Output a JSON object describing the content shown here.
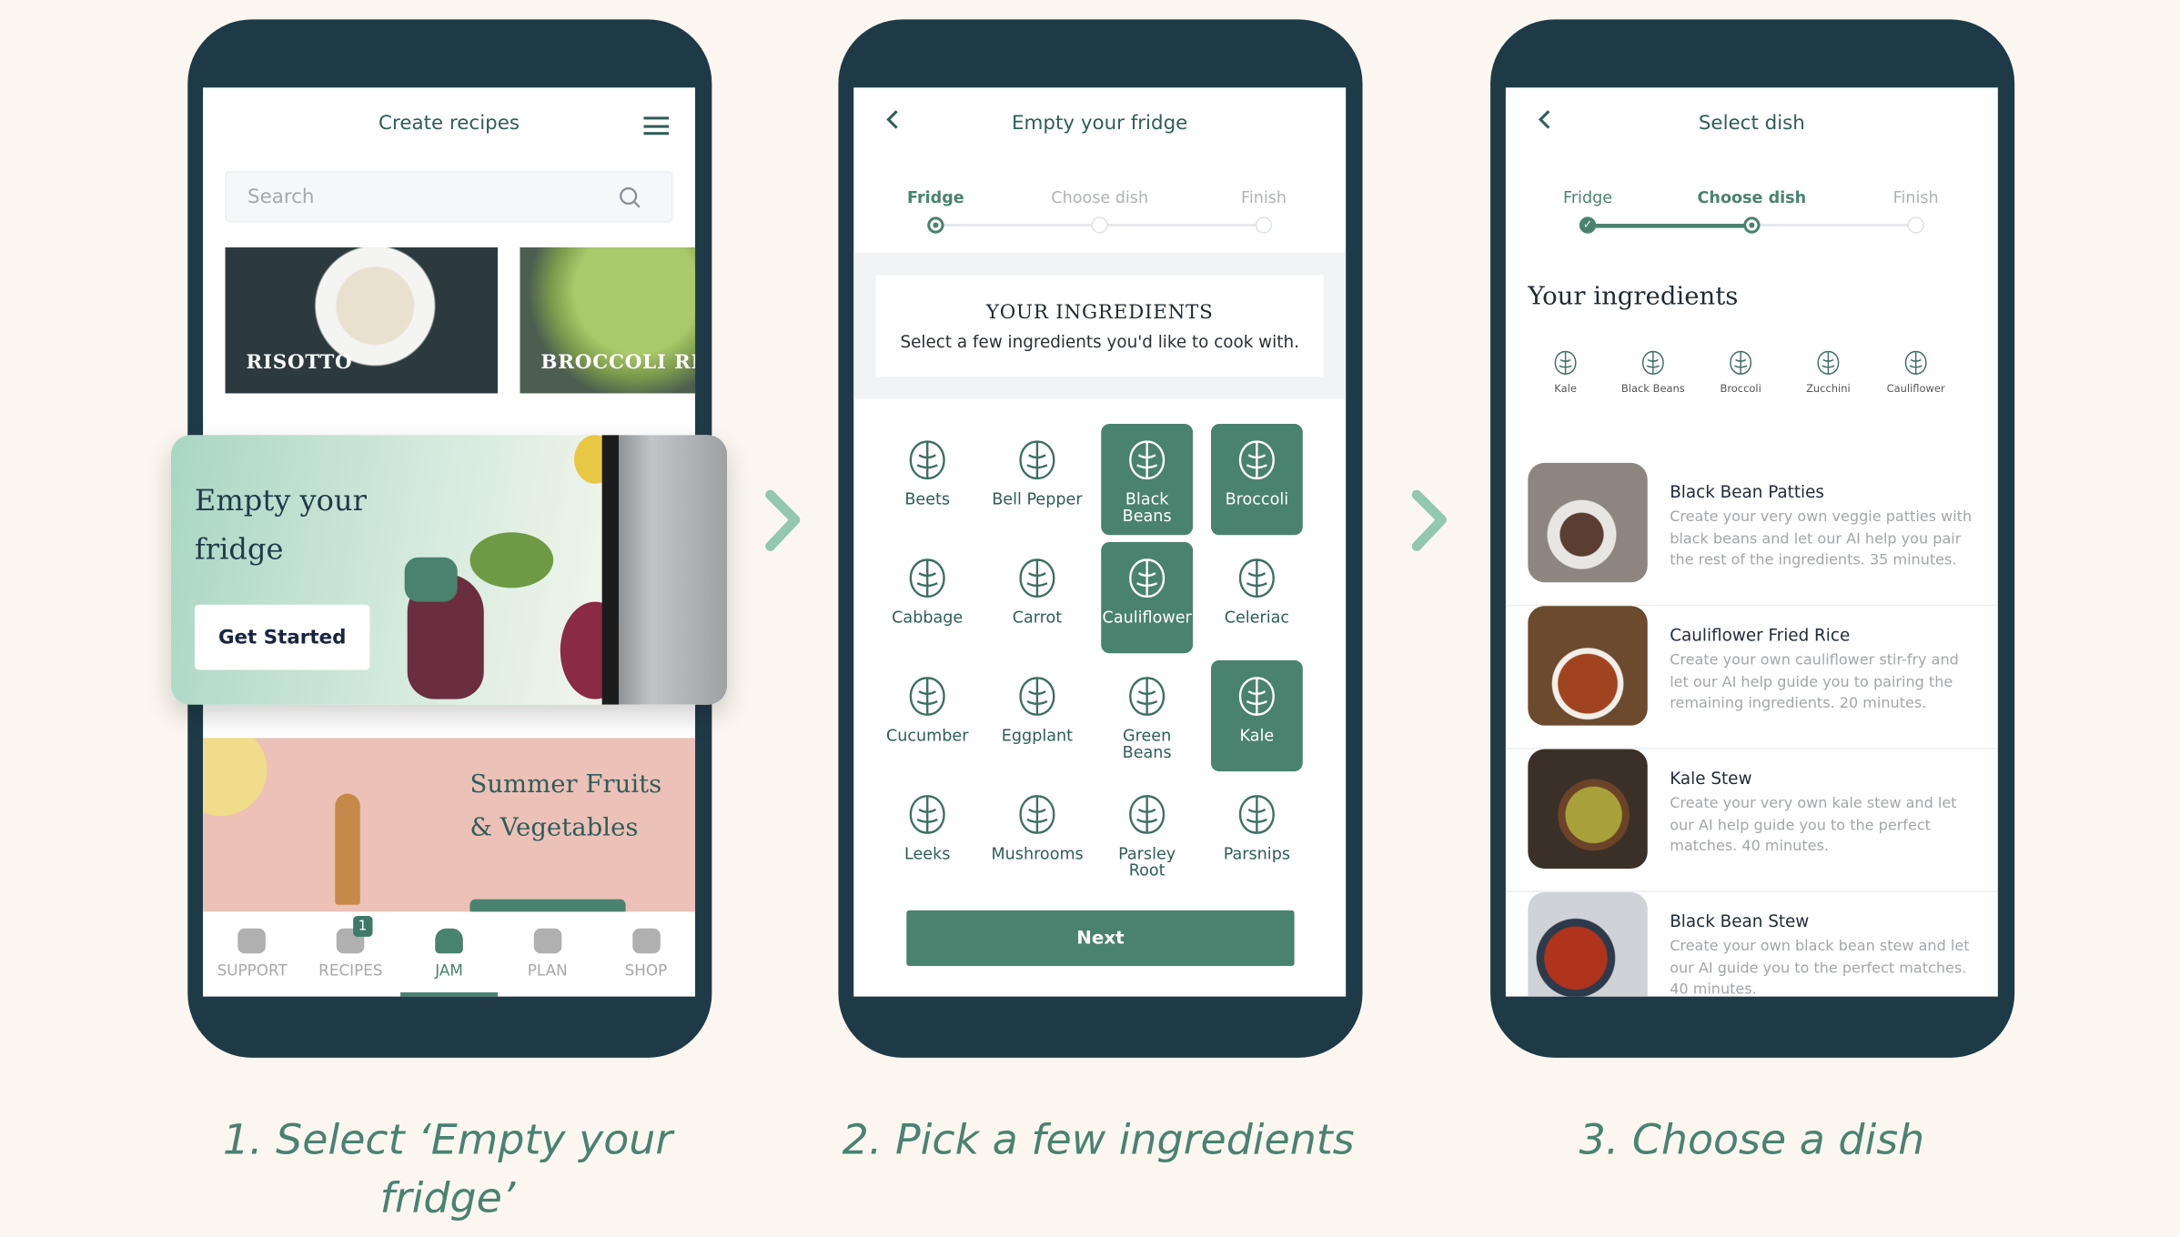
{
  "colors": {
    "accent": "#4a8270",
    "phone": "#1f3a47",
    "background": "#fbf7f0",
    "banner_pink": "#ecc1b8"
  },
  "screen1": {
    "title": "Create recipes",
    "search_placeholder": "Search",
    "recipes": [
      "RISOTTO",
      "BROCCOLI RIC"
    ],
    "banner": {
      "title": "Empty your fridge",
      "button": "Get Started"
    },
    "promo": "Summer Fruits & Vegetables",
    "nav": [
      {
        "label": "SUPPORT",
        "icon": "chat-icon"
      },
      {
        "label": "RECIPES",
        "icon": "book-icon",
        "badge": "1"
      },
      {
        "label": "JAM",
        "icon": "chef-hat-icon",
        "active": true
      },
      {
        "label": "PLAN",
        "icon": "calendar-icon"
      },
      {
        "label": "SHOP",
        "icon": "shopping-bag-icon"
      }
    ]
  },
  "screen2": {
    "title": "Empty your fridge",
    "steps": [
      "Fridge",
      "Choose dish",
      "Finish"
    ],
    "card_title": "YOUR INGREDIENTS",
    "card_subtitle": "Select a few ingredients you'd like to cook with.",
    "ingredients": [
      {
        "label": "Beets",
        "selected": false
      },
      {
        "label": "Bell Pepper",
        "selected": false
      },
      {
        "label": "Black Beans",
        "selected": true
      },
      {
        "label": "Broccoli",
        "selected": true
      },
      {
        "label": "Cabbage",
        "selected": false
      },
      {
        "label": "Carrot",
        "selected": false
      },
      {
        "label": "Cauliflower",
        "selected": true
      },
      {
        "label": "Celeriac",
        "selected": false
      },
      {
        "label": "Cucumber",
        "selected": false
      },
      {
        "label": "Eggplant",
        "selected": false
      },
      {
        "label": "Green Beans",
        "selected": false
      },
      {
        "label": "Kale",
        "selected": true
      },
      {
        "label": "Leeks",
        "selected": false
      },
      {
        "label": "Mushrooms",
        "selected": false
      },
      {
        "label": "Parsley Root",
        "selected": false
      },
      {
        "label": "Parsnips",
        "selected": false
      }
    ],
    "next": "Next"
  },
  "screen3": {
    "title": "Select dish",
    "steps": [
      "Fridge",
      "Choose dish",
      "Finish"
    ],
    "heading": "Your ingredients",
    "chips": [
      "Kale",
      "Black Beans",
      "Broccoli",
      "Zucchini",
      "Cauliflower"
    ],
    "dishes": [
      {
        "title": "Black Bean Patties",
        "desc": "Create your very own veggie patties with black beans and let our AI help you pair the rest of the ingredients. 35 minutes."
      },
      {
        "title": "Cauliflower Fried Rice",
        "desc": "Create your own cauliflower stir-fry and let our AI help guide you to pairing the remaining ingredients. 20 minutes."
      },
      {
        "title": "Kale Stew",
        "desc": "Create your very own kale stew and let our AI help guide you to the perfect matches. 40 minutes."
      },
      {
        "title": "Black Bean Stew",
        "desc": "Create your own black bean stew and let our AI guide you to the perfect matches. 40 minutes."
      }
    ]
  },
  "captions": [
    "1. Select ‘Empty your fridge’",
    "2. Pick a few ingredients",
    "3. Choose a dish"
  ]
}
